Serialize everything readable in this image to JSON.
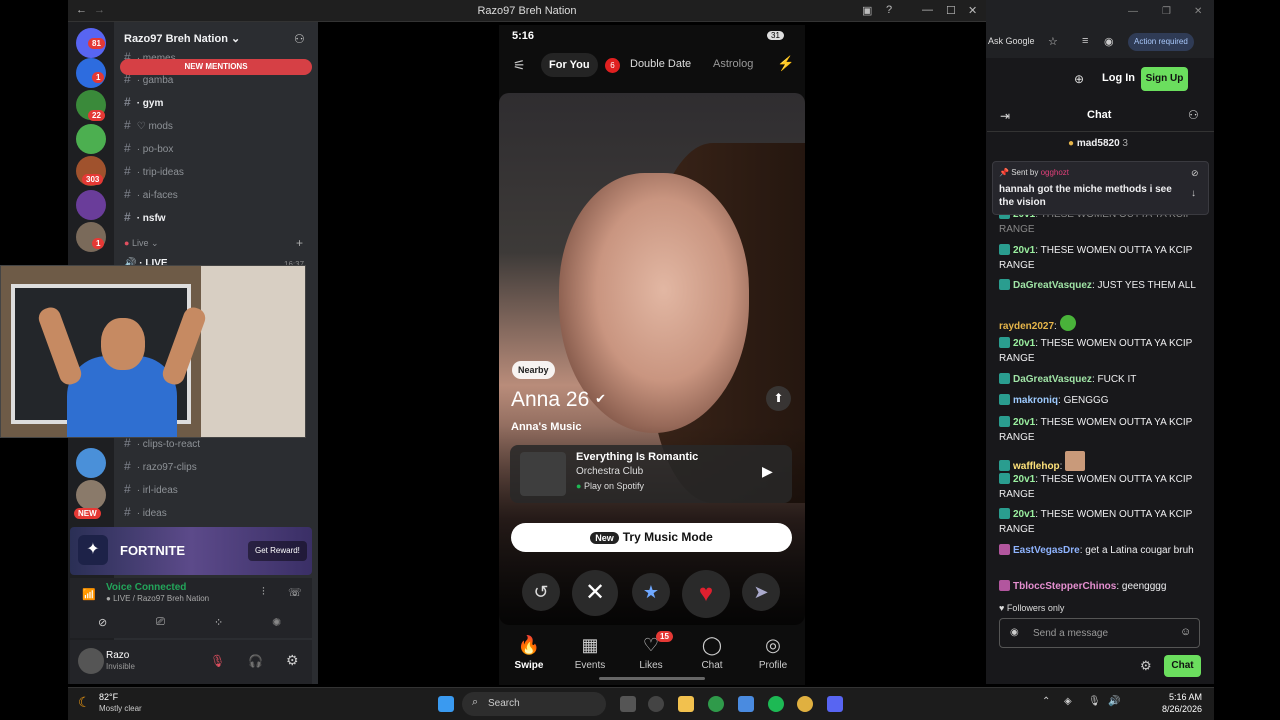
{
  "mirror": {
    "title": "Razo97 Breh Nation"
  },
  "discord": {
    "server_name": "Razo97 Breh Nation",
    "new_mentions": "NEW MENTIONS",
    "server_badges": [
      "81",
      "1",
      "22",
      "303",
      "1",
      "1"
    ],
    "new_label": "NEW",
    "channels": [
      {
        "name": "memes",
        "bold": false
      },
      {
        "name": "gamba",
        "bold": false
      },
      {
        "name": "gym",
        "bold": true
      },
      {
        "name": "mods",
        "bold": false
      },
      {
        "name": "po-box",
        "bold": false
      },
      {
        "name": "trip-ideas",
        "bold": false
      },
      {
        "name": "ai-faces",
        "bold": false
      },
      {
        "name": "nsfw",
        "bold": true
      }
    ],
    "live_category": "Live",
    "live_channel": "LIVE",
    "live_time": "16:37",
    "lower_channels": [
      "clips-to-react",
      "razo97-clips",
      "irl-ideas",
      "ideas"
    ],
    "promo": {
      "title": "FORTNITE",
      "button": "Get Reward!"
    },
    "voice": {
      "status": "Voice Connected",
      "channel": "LIVE / Razo97 Breh Nation"
    },
    "user": {
      "name": "Razo",
      "status": "Invisible"
    }
  },
  "phone": {
    "status_time": "5:16",
    "battery": "31",
    "tabs": {
      "for_you": "For You",
      "double_date_badge": "6",
      "double_date": "Double Date",
      "astrology": "Astrolog"
    },
    "profile": {
      "nearby": "Nearby",
      "name": "Anna",
      "age": "26",
      "music_label": "Anna's Music",
      "song": "Everything Is Romantic",
      "artist": "Orchestra Club",
      "spotify": "Play on Spotify"
    },
    "music_mode": {
      "new": "New",
      "label": "Try Music Mode"
    },
    "nav": [
      {
        "label": "Swipe",
        "icon": "🔥"
      },
      {
        "label": "Events",
        "icon": "▦"
      },
      {
        "label": "Likes",
        "icon": "♡",
        "badge": "15"
      },
      {
        "label": "Chat",
        "icon": "◯"
      },
      {
        "label": "Profile",
        "icon": "◎"
      }
    ]
  },
  "browser": {
    "ask_google": "Ask Google",
    "action_required": "Action required",
    "log_in": "Log In",
    "sign_up": "Sign Up"
  },
  "chat": {
    "title": "Chat",
    "top_user": "mad5820",
    "top_count": "3",
    "pinned_sent_by": "Sent by",
    "pinned_user": "ogghozt",
    "pinned_text": "hannah got the miche methods i see the vision",
    "messages": [
      {
        "user": "20v1",
        "color": "#9bf0a0",
        "text": "THESE WOMEN OUTTA YA KCIP RANGE"
      },
      {
        "user": "20v1",
        "color": "#9bf0a0",
        "text": "THESE WOMEN OUTTA YA KCIP RANGE"
      },
      {
        "user": "DaGreatVasquez",
        "color": "#a0e4a6",
        "text": "JUST YES THEM ALL"
      },
      {
        "user": "rayden2027",
        "color": "#e6b54a",
        "text": ""
      },
      {
        "user": "20v1",
        "color": "#9bf0a0",
        "text": "THESE WOMEN OUTTA YA KCIP RANGE"
      },
      {
        "user": "DaGreatVasquez",
        "color": "#a0e4a6",
        "text": "FUCK IT"
      },
      {
        "user": "makroniq",
        "color": "#9ecbff",
        "text": "GENGGG"
      },
      {
        "user": "20v1",
        "color": "#9bf0a0",
        "text": "THESE WOMEN OUTTA YA KCIP RANGE"
      },
      {
        "user": "wafflehop",
        "color": "#ffe27a",
        "text": ""
      },
      {
        "user": "20v1",
        "color": "#9bf0a0",
        "text": "THESE WOMEN OUTTA YA KCIP RANGE"
      },
      {
        "user": "20v1",
        "color": "#9bf0a0",
        "text": "THESE WOMEN OUTTA YA KCIP RANGE"
      },
      {
        "user": "EastVegasDre",
        "color": "#8fb4ff",
        "text": "get a Latina cougar bruh"
      },
      {
        "user": "TbloccStepperChinos",
        "color": "#e58fd0",
        "text": "geengggg"
      }
    ],
    "followers_only": "Followers only",
    "input_placeholder": "Send a message",
    "chat_button": "Chat"
  },
  "taskbar": {
    "temp": "82°F",
    "weather": "Mostly clear",
    "search": "Search",
    "time": "5:16 AM",
    "date": "8/26/2026"
  }
}
